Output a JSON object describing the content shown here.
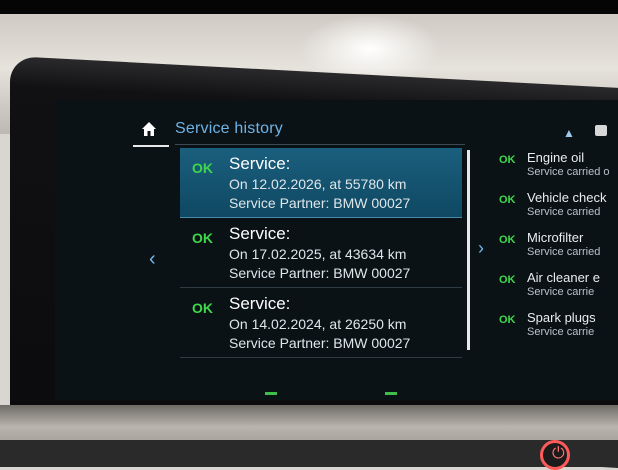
{
  "header": {
    "title": "Service history"
  },
  "service_list": [
    {
      "status": "OK",
      "title": "Service:",
      "date_line": "On 12.02.2026, at 55780 km",
      "partner_line": "Service Partner: BMW 00027",
      "selected": true
    },
    {
      "status": "OK",
      "title": "Service:",
      "date_line": "On 17.02.2025, at 43634 km",
      "partner_line": "Service Partner: BMW 00027",
      "selected": false
    },
    {
      "status": "OK",
      "title": "Service:",
      "date_line": "On 14.02.2024, at 26250 km",
      "partner_line": "Service Partner: BMW 00027",
      "selected": false
    }
  ],
  "detail_list": [
    {
      "status": "OK",
      "name": "Engine oil",
      "sub": "Service carried o"
    },
    {
      "status": "OK",
      "name": "Vehicle check",
      "sub": "Service carried"
    },
    {
      "status": "OK",
      "name": "Microfilter",
      "sub": "Service carried"
    },
    {
      "status": "OK",
      "name": "Air cleaner e",
      "sub": "Service carrie"
    },
    {
      "status": "OK",
      "name": "Spark plugs",
      "sub": "Service carrie"
    }
  ],
  "icons": {
    "home": "home-icon",
    "nav_left": "chevron-left-icon",
    "nav_right": "chevron-right-icon",
    "up": "chevron-up-icon",
    "menu": "square-icon"
  },
  "colors": {
    "accent": "#6fb3e6",
    "ok": "#3ed84a",
    "selected": "#1a5f7e",
    "screen": "#0a1216"
  }
}
